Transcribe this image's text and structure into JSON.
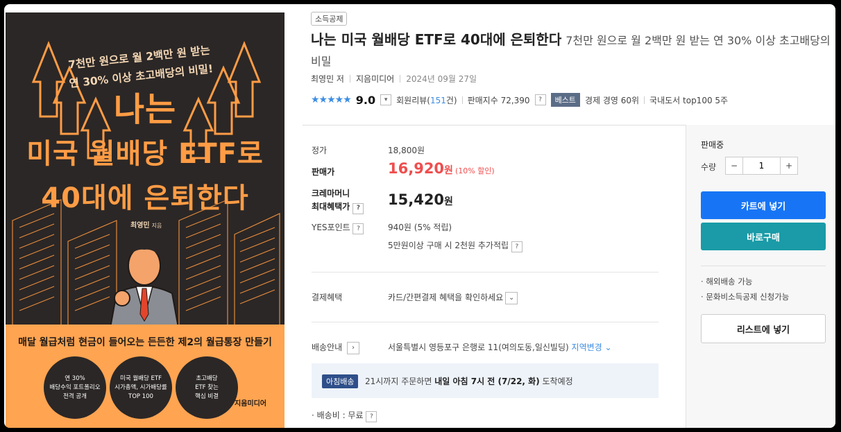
{
  "cover": {
    "tagline_1": "7천만 원으로 월 2백만 원 받는",
    "tagline_2": "연 30% 이상 초고배당의 비밀!",
    "title_1": "나는",
    "title_2": "미국 월배당 ETF로",
    "title_3": "40대에 은퇴한다",
    "author": "최영민",
    "author_suffix": "지음",
    "band_text": "매달 월급처럼 현금이 들어오는 든든한 제2의 월급통장 만들기",
    "circles": [
      {
        "line1": "연 30%",
        "line2": "배당수익 포트폴리오",
        "line3": "전격 공개"
      },
      {
        "line1": "미국 월배당 ETF",
        "line2": "시가총액, 시가배당률",
        "line3": "TOP 100"
      },
      {
        "line1": "초고배당",
        "line2": "ETF 찾는",
        "line3": "핵심 비결"
      }
    ],
    "publisher": "지음미디어"
  },
  "product": {
    "badge": "소득공제",
    "title": "나는 미국 월배당 ETF로 40대에 은퇴한다",
    "subtitle": "7천만 원으로 월 2백만 원 받는 연 30% 이상 초고배당의 비밀",
    "author": "최영민 저",
    "publisher": "지음미디어",
    "date": "2024년 09월 27일",
    "stars": "★★★★★",
    "score": "9.0",
    "review_label": "회원리뷰(",
    "review_count": "151",
    "review_suffix": "건)",
    "sales_index": "판매지수 72,390",
    "best_tag": "베스트",
    "rank_1": "경제 경영 60위",
    "rank_2": "국내도서 top100 5주"
  },
  "pricing": {
    "list_label": "정가",
    "list_price": "18,800원",
    "sale_label": "판매가",
    "sale_price": "16,920",
    "sale_won": "원",
    "discount": "(10% 할인)",
    "crema_label_1": "크레마머니",
    "crema_label_2": "최대혜택가",
    "crema_price": "15,420",
    "crema_won": "원",
    "point_label": "YES포인트",
    "point_value": "940원 (5% 적립)",
    "point_extra": "5만원이상 구매 시 2천원 추가적립"
  },
  "payment": {
    "label": "결제혜택",
    "value": "카드/간편결제 혜택을 확인하세요"
  },
  "shipping": {
    "label": "배송안내",
    "address": "서울특별시 영등포구 은행로 11(여의도동,일신빌딩)",
    "change": "지역변경",
    "morning_tag": "아침배송",
    "msg_pre": "21시까지 주문하면",
    "msg_bold": "내일 아침 7시 전 (7/22, 화)",
    "msg_post": "도착예정",
    "fee": "배송비 : 무료"
  },
  "panel": {
    "status": "판매중",
    "qty_label": "수량",
    "qty_value": "1",
    "cart_button": "카트에 넣기",
    "buy_button": "바로구매",
    "overseas": "해외배송 가능",
    "culture": "문화비소득공제 신청가능",
    "list_button": "리스트에 넣기"
  },
  "colors": {
    "cover_bg": "#2b2726",
    "cover_orange": "#ffa451",
    "sale_red": "#ef4e4e",
    "cart_blue": "#1775f5",
    "buy_teal": "#1a9ba7",
    "star_blue": "#3d8de2"
  }
}
